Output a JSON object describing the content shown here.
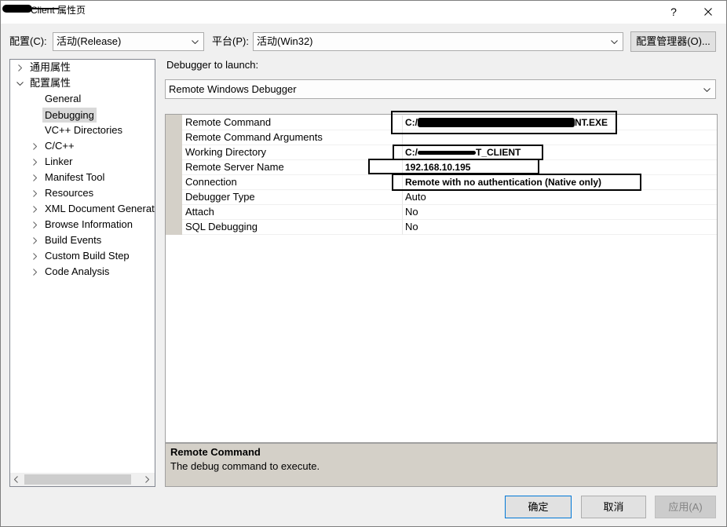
{
  "window": {
    "title": "Client 属性页",
    "help": "?"
  },
  "toolbar": {
    "config_label": "配置(C):",
    "config_value": "活动(Release)",
    "platform_label": "平台(P):",
    "platform_value": "活动(Win32)",
    "config_manager_label": "配置管理器(O)..."
  },
  "tree": {
    "items": [
      {
        "label": "通用属性",
        "icon": "chevron-right-icon"
      },
      {
        "label": "配置属性",
        "icon": "chevron-down-icon"
      },
      {
        "label": "General"
      },
      {
        "label": "Debugging",
        "selected": true
      },
      {
        "label": "VC++ Directories"
      },
      {
        "label": "C/C++",
        "icon": "chevron-right-icon"
      },
      {
        "label": "Linker",
        "icon": "chevron-right-icon"
      },
      {
        "label": "Manifest Tool",
        "icon": "chevron-right-icon"
      },
      {
        "label": "Resources",
        "icon": "chevron-right-icon"
      },
      {
        "label": "XML Document Generat",
        "icon": "chevron-right-icon"
      },
      {
        "label": "Browse Information",
        "icon": "chevron-right-icon"
      },
      {
        "label": "Build Events",
        "icon": "chevron-right-icon"
      },
      {
        "label": "Custom Build Step",
        "icon": "chevron-right-icon"
      },
      {
        "label": "Code Analysis",
        "icon": "chevron-right-icon"
      }
    ]
  },
  "debugger": {
    "label": "Debugger to launch:",
    "value": "Remote Windows Debugger"
  },
  "grid": {
    "rows": [
      {
        "name": "Remote Command",
        "value_start": "C:/",
        "value_end": "NT.EXE",
        "modified": true
      },
      {
        "name": "Remote Command Arguments",
        "value": ""
      },
      {
        "name": "Working Directory",
        "value_start": "C:/",
        "value_end": "T_CLIENT",
        "modified": true
      },
      {
        "name": "Remote Server Name",
        "value": "192.168.10.195",
        "modified": true
      },
      {
        "name": "Connection",
        "value": "Remote with no authentication (Native only)",
        "modified": true
      },
      {
        "name": "Debugger Type",
        "value": "Auto"
      },
      {
        "name": "Attach",
        "value": "No"
      },
      {
        "name": "SQL Debugging",
        "value": "No"
      }
    ]
  },
  "description": {
    "title": "Remote Command",
    "text": "The debug command to execute."
  },
  "buttons": {
    "ok": "确定",
    "cancel": "取消",
    "apply": "应用(A)"
  },
  "icons": {
    "close": "close-icon",
    "combo": "chevron-down-icon",
    "scroll_left": "chevron-left-icon",
    "scroll_right": "chevron-right-icon"
  },
  "colors": {
    "accent": "#0078d7",
    "selection": "#d9d9d9",
    "panel": "#d4d0c8",
    "annotation": "#000000"
  }
}
